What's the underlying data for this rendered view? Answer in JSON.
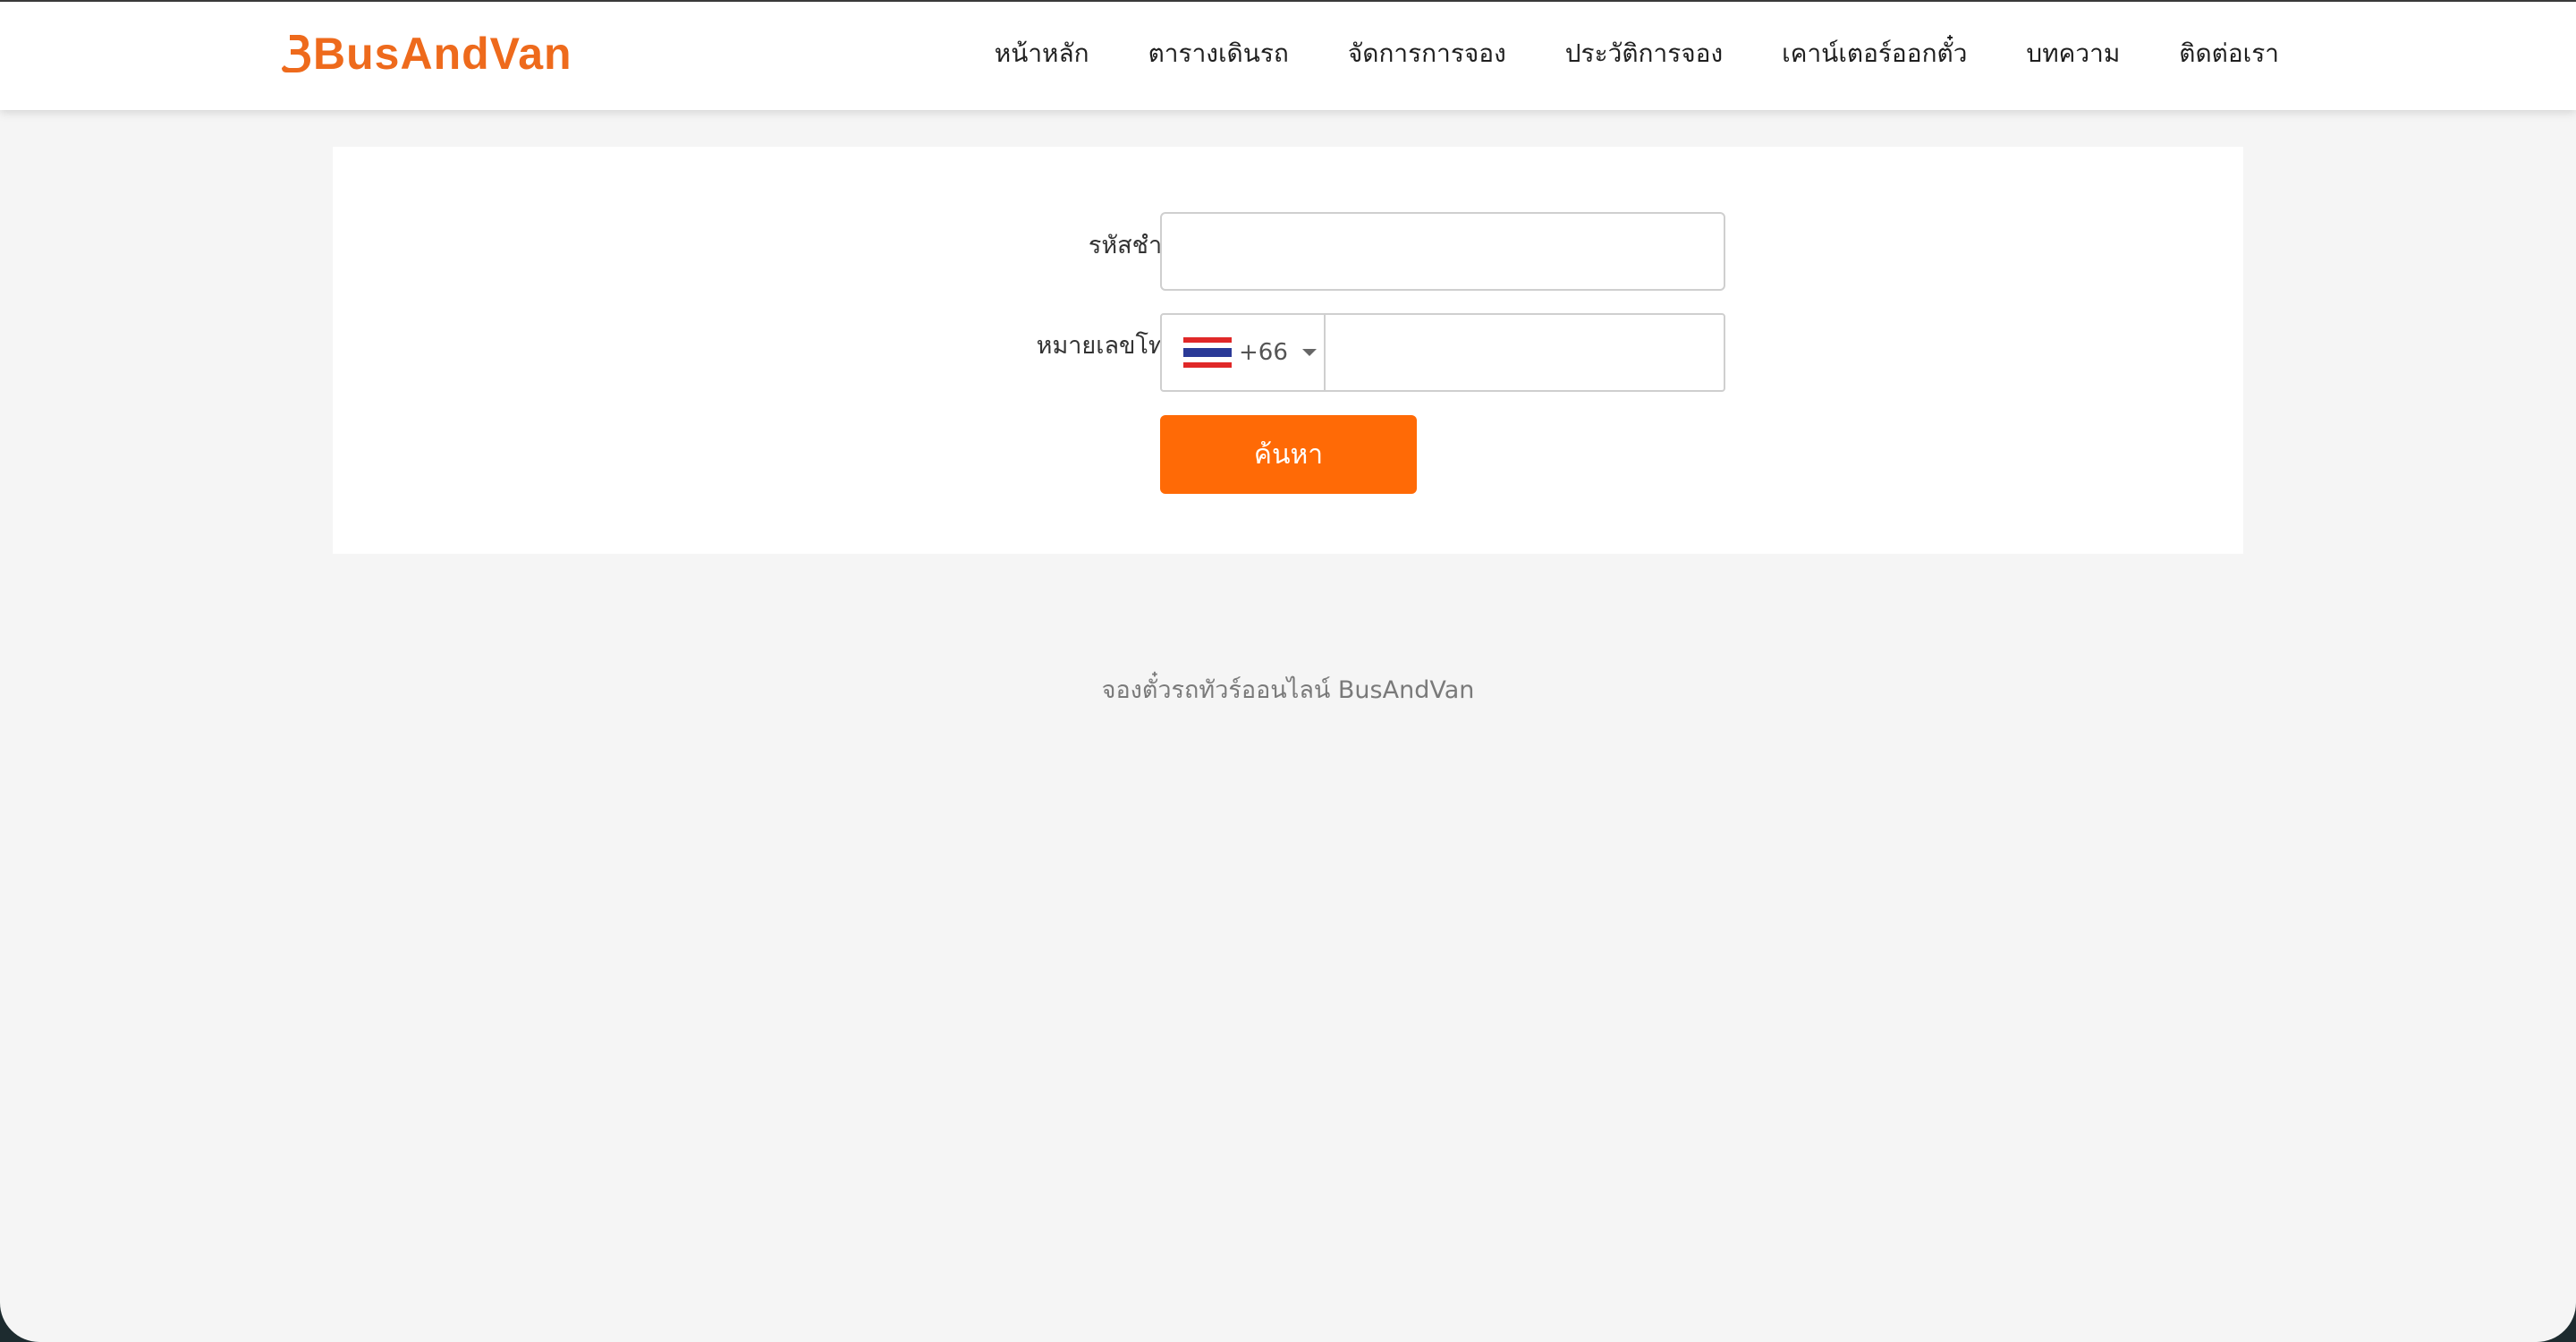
{
  "brand": {
    "name": "BusAndVan",
    "color": "#ee6a1c"
  },
  "nav": {
    "items": [
      {
        "label": "หน้าหลัก"
      },
      {
        "label": "ตารางเดินรถ"
      },
      {
        "label": "จัดการการจอง"
      },
      {
        "label": "ประวัติการจอง"
      },
      {
        "label": "เคาน์เตอร์ออกตั๋ว"
      },
      {
        "label": "บทความ"
      },
      {
        "label": "ติดต่อเรา"
      }
    ]
  },
  "form": {
    "payment_code_label": "รหัสชำระเงิน",
    "payment_code_value": "",
    "phone_label": "หมายเลขโทรศัพท์",
    "country": {
      "flag_icon": "thailand-flag-icon",
      "dial_code": "+66"
    },
    "phone_value": "",
    "search_label": "ค้นหา",
    "button_color": "#ff6a06"
  },
  "footer": {
    "text": "จองตั๋วรถทัวร์ออนไลน์ BusAndVan"
  }
}
